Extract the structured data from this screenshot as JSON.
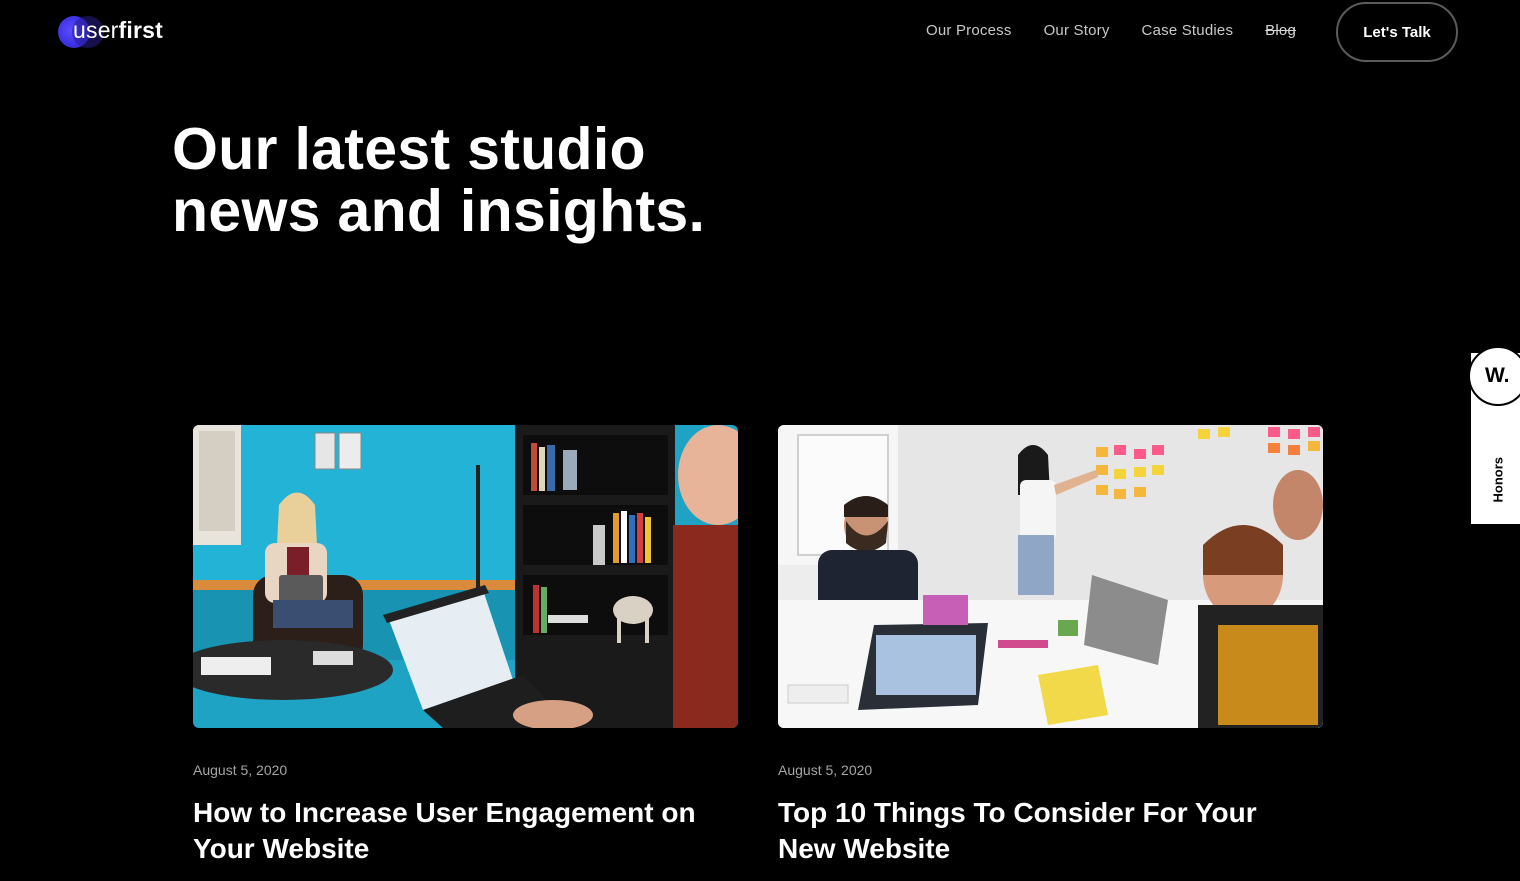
{
  "brand": {
    "logo_thin": "user",
    "logo_bold": "first"
  },
  "nav": {
    "items": [
      "Our Process",
      "Our Story",
      "Case Studies",
      "Blog"
    ],
    "cta_label": "Let's Talk"
  },
  "hero": {
    "title_line1": "Our latest studio",
    "title_line2": "news and insights."
  },
  "honors": {
    "badge": "W.",
    "label": "Honors"
  },
  "posts": [
    {
      "date": "August 5, 2020",
      "title": "How to Increase User Engagement on Your Website",
      "image": "woman with laptop in blue office, man typing on laptop in foreground"
    },
    {
      "date": "August 5, 2020",
      "title": "Top 10 Things To Consider For Your New Website",
      "image": "team meeting around white table, woman pointing at sticky notes on wall"
    }
  ],
  "colors": {
    "background": "#000000",
    "accent": "#3a2fe0",
    "text": "#ffffff",
    "muted": "#a5a5a5"
  }
}
